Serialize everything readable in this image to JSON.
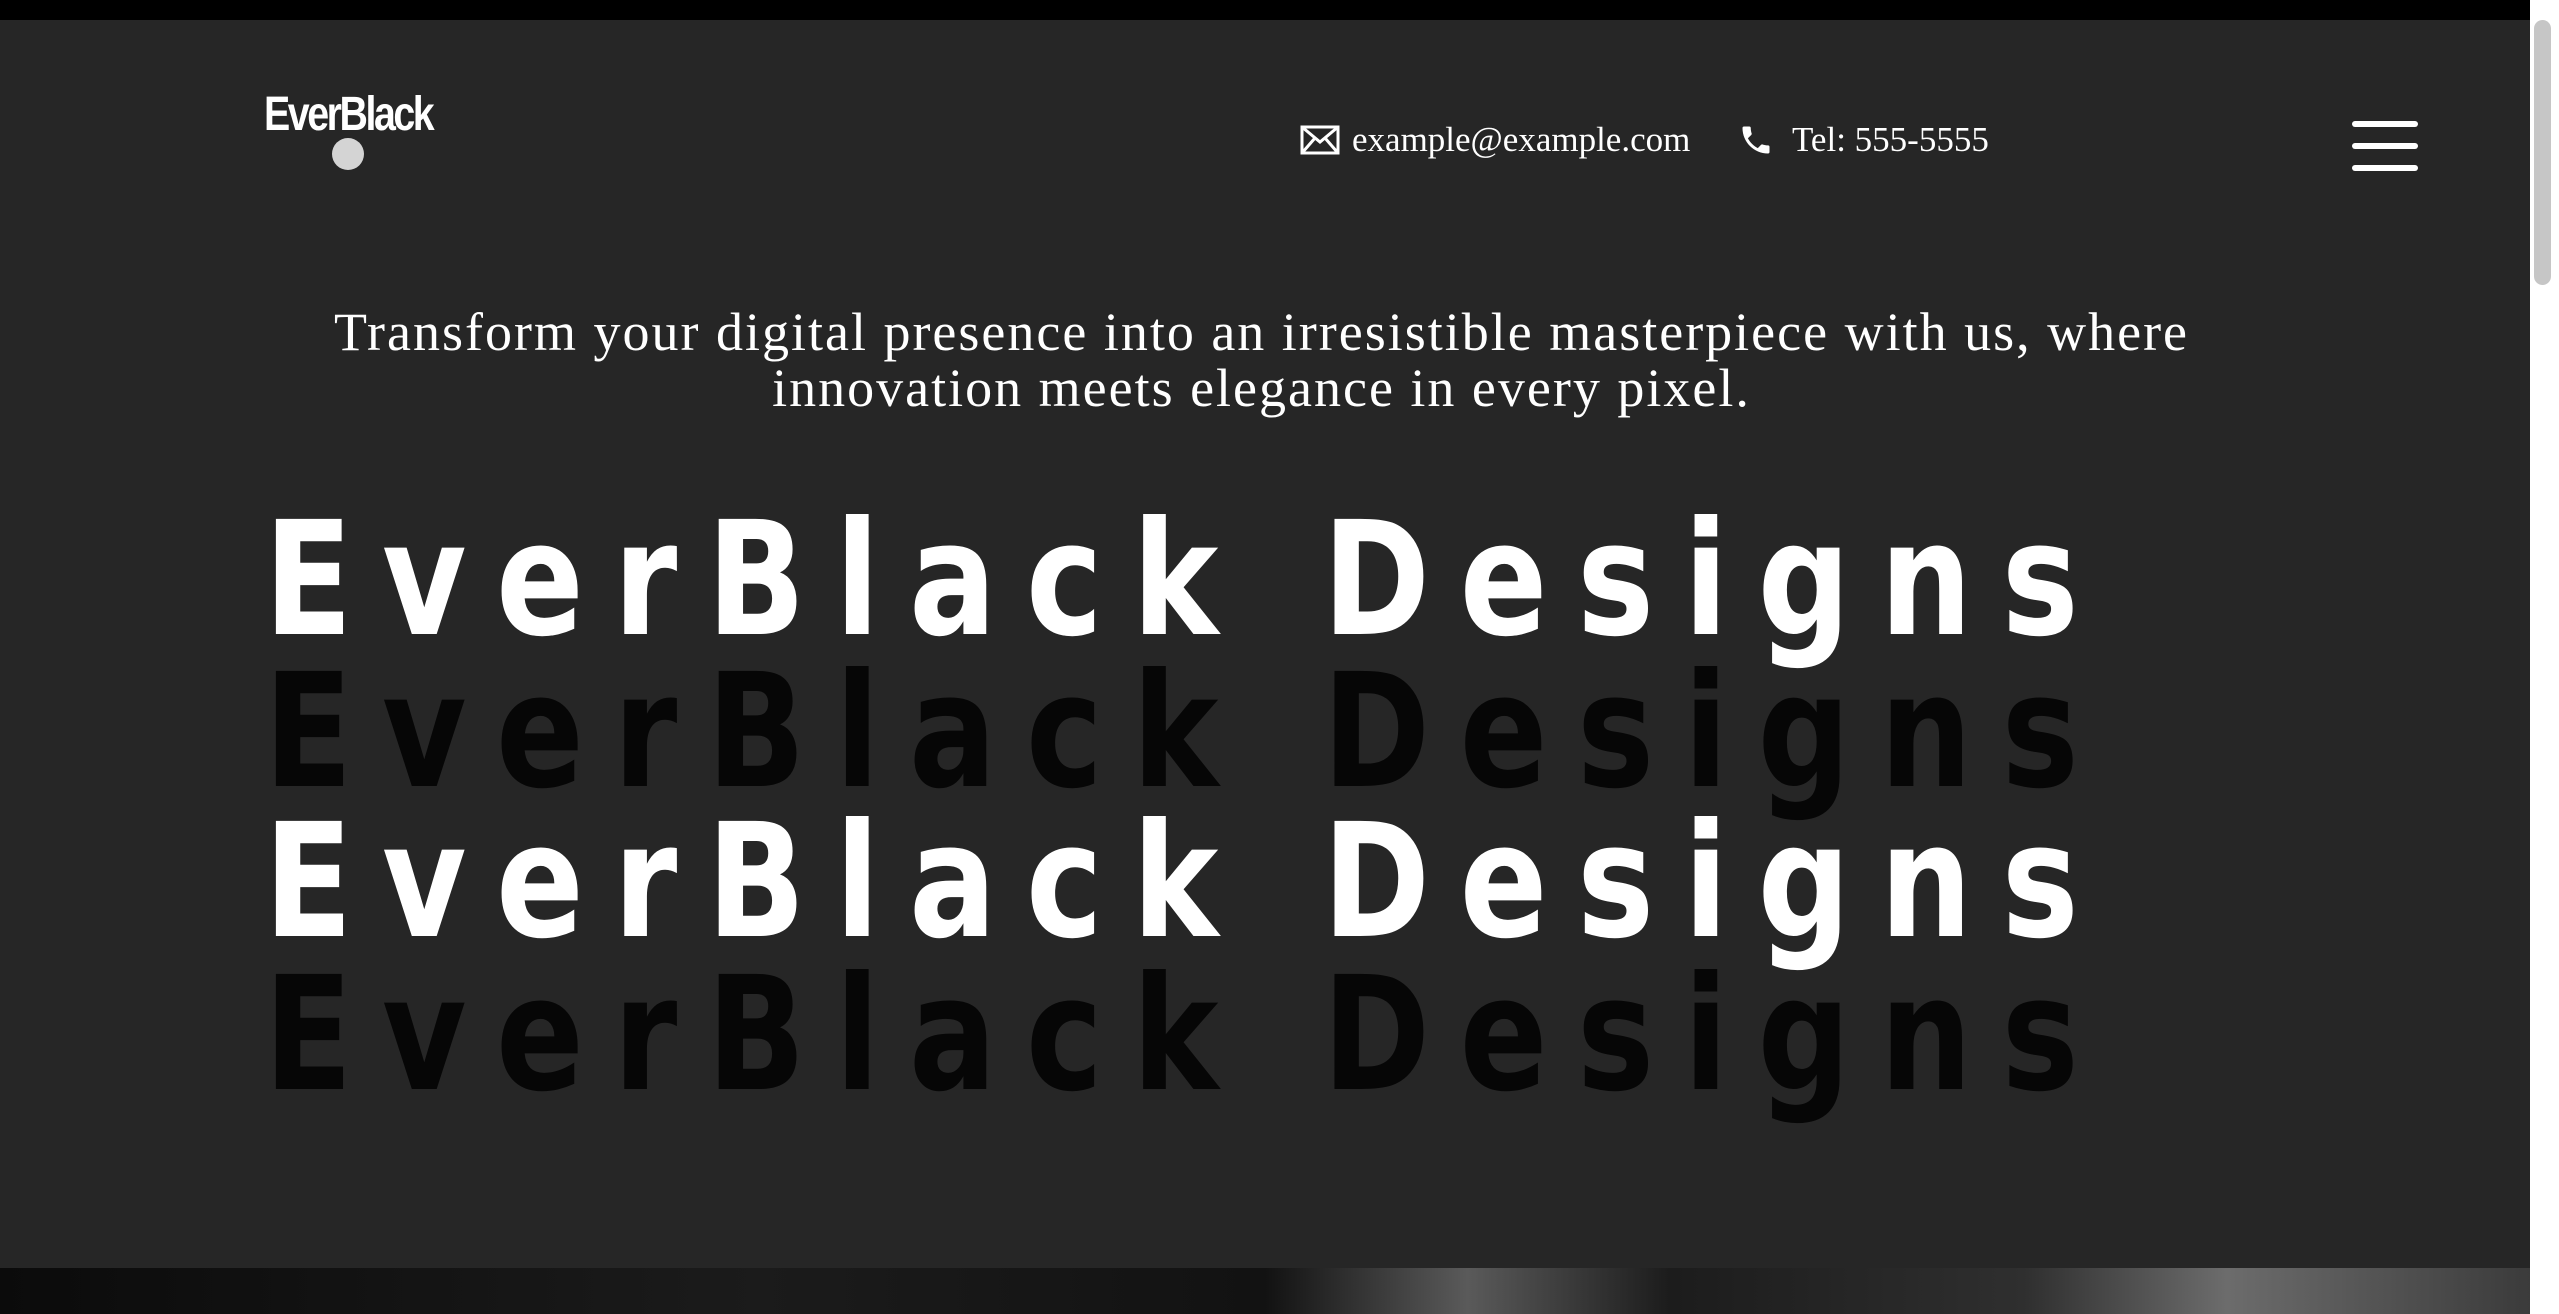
{
  "header": {
    "logo_text": "EverBlack",
    "email": "example@example.com",
    "phone": "Tel: 555-5555",
    "email_icon": "envelope-icon",
    "phone_icon": "phone-icon",
    "menu_icon": "hamburger-menu-icon"
  },
  "hero": {
    "tagline": "Transform your digital presence into an irresistible masterpiece with us, where innovation meets elegance in every pixel.",
    "title_lines": [
      "EverBlack Designs",
      "EverBlack Designs",
      "EverBlack Designs",
      "EverBlack Designs"
    ]
  },
  "colors": {
    "background": "#262626",
    "top_bar": "#000000",
    "text": "#ffffff",
    "title_dark": "#060606"
  }
}
